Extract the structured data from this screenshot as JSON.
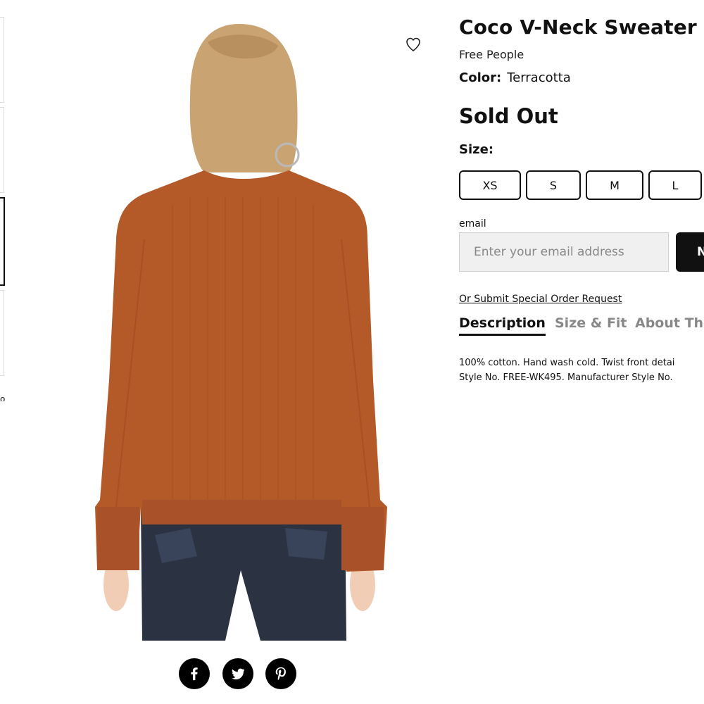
{
  "product": {
    "title": "Coco V-Neck Sweater",
    "brand": "Free People",
    "color_label": "Color:",
    "color_value": "Terracotta",
    "status": "Sold Out",
    "size_label": "Size:",
    "sizes": [
      "XS",
      "S",
      "M",
      "L"
    ]
  },
  "notify": {
    "email_label": "email",
    "email_placeholder": "Enter your email address",
    "button_label": "N",
    "special_order_link": "Or Submit Special Order Request"
  },
  "tabs": [
    {
      "label": "Description",
      "active": true
    },
    {
      "label": "Size & Fit",
      "active": false
    },
    {
      "label": "About The",
      "active": false
    }
  ],
  "description": {
    "line1": "100% cotton. Hand wash cold. Twist front detai",
    "line2": "Style No. FREE-WK495. Manufacturer Style No."
  },
  "gallery": {
    "more_link": "o",
    "wishlist_icon": "heart-icon",
    "sweater_color": "#b45a28",
    "jeans_color": "#2b3342"
  },
  "social": [
    "facebook-icon",
    "twitter-icon",
    "pinterest-icon"
  ]
}
